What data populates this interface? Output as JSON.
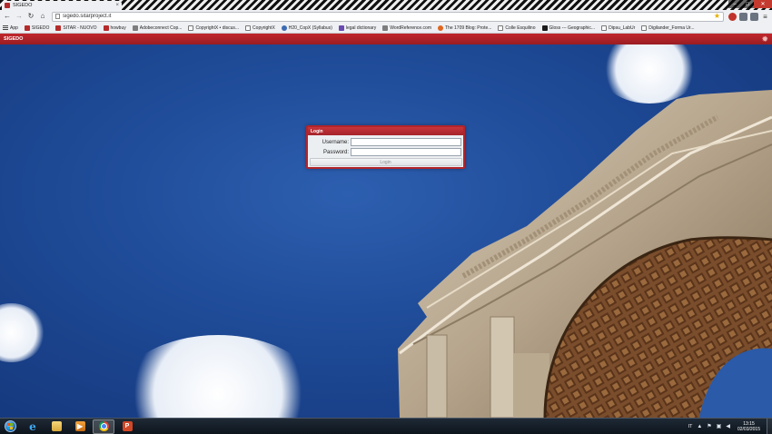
{
  "browser": {
    "tab_title": "SIGEDO",
    "tab_close": "×",
    "window_controls": {
      "minimize": "–",
      "maximize": "□",
      "close": "✕"
    },
    "url": "sigedo.sitarproject.it",
    "nav": {
      "back": "←",
      "forward": "→",
      "reload": "↻",
      "home": "⌂"
    },
    "star": "★",
    "menu": "≡",
    "bookmarks": [
      {
        "label": "App",
        "icon": "apps-grid-icon"
      },
      {
        "label": "SIGEDO",
        "icon": "sigedo-favicon"
      },
      {
        "label": "SITAR - NUOVO",
        "icon": "sitar-favicon"
      },
      {
        "label": "howbuy",
        "icon": "howbuy-favicon"
      },
      {
        "label": "Adobeconnect Cop...",
        "icon": "adobe-favicon"
      },
      {
        "label": "CopyrightX • discus...",
        "icon": "document-icon"
      },
      {
        "label": "CopyrightX",
        "icon": "document-icon"
      },
      {
        "label": "H20_CopX (Syllabus)",
        "icon": "h2o-favicon"
      },
      {
        "label": "legal dictionary",
        "icon": "dictionary-favicon"
      },
      {
        "label": "WordReference.com",
        "icon": "wordreference-favicon"
      },
      {
        "label": "The 1709 Blog: Prote...",
        "icon": "blogger-favicon"
      },
      {
        "label": "Colle Esquilino",
        "icon": "document-icon"
      },
      {
        "label": "Gloss --- Geographic...",
        "icon": "gloss-favicon"
      },
      {
        "label": "Dipsu_LabUr",
        "icon": "document-icon"
      },
      {
        "label": "Digilander_Forma Ur...",
        "icon": "document-icon"
      }
    ]
  },
  "app": {
    "brand": "SIGEDO",
    "login": {
      "title": "Login",
      "username_label": "Username:",
      "password_label": "Password:",
      "username_value": "",
      "password_value": "",
      "submit_label": "Login"
    }
  },
  "taskbar": {
    "apps": [
      {
        "name": "internet-explorer",
        "glyph": "e",
        "active": false
      },
      {
        "name": "file-explorer",
        "glyph": "",
        "active": false
      },
      {
        "name": "media-player",
        "glyph": "▶",
        "active": false
      },
      {
        "name": "google-chrome",
        "glyph": "",
        "active": true
      },
      {
        "name": "powerpoint",
        "glyph": "P",
        "active": false
      }
    ],
    "language": "IT",
    "time": "13:15",
    "date": "02/03/2015"
  },
  "colors": {
    "accent_red": "#b3242a",
    "sky_blue": "#1e4a96"
  }
}
